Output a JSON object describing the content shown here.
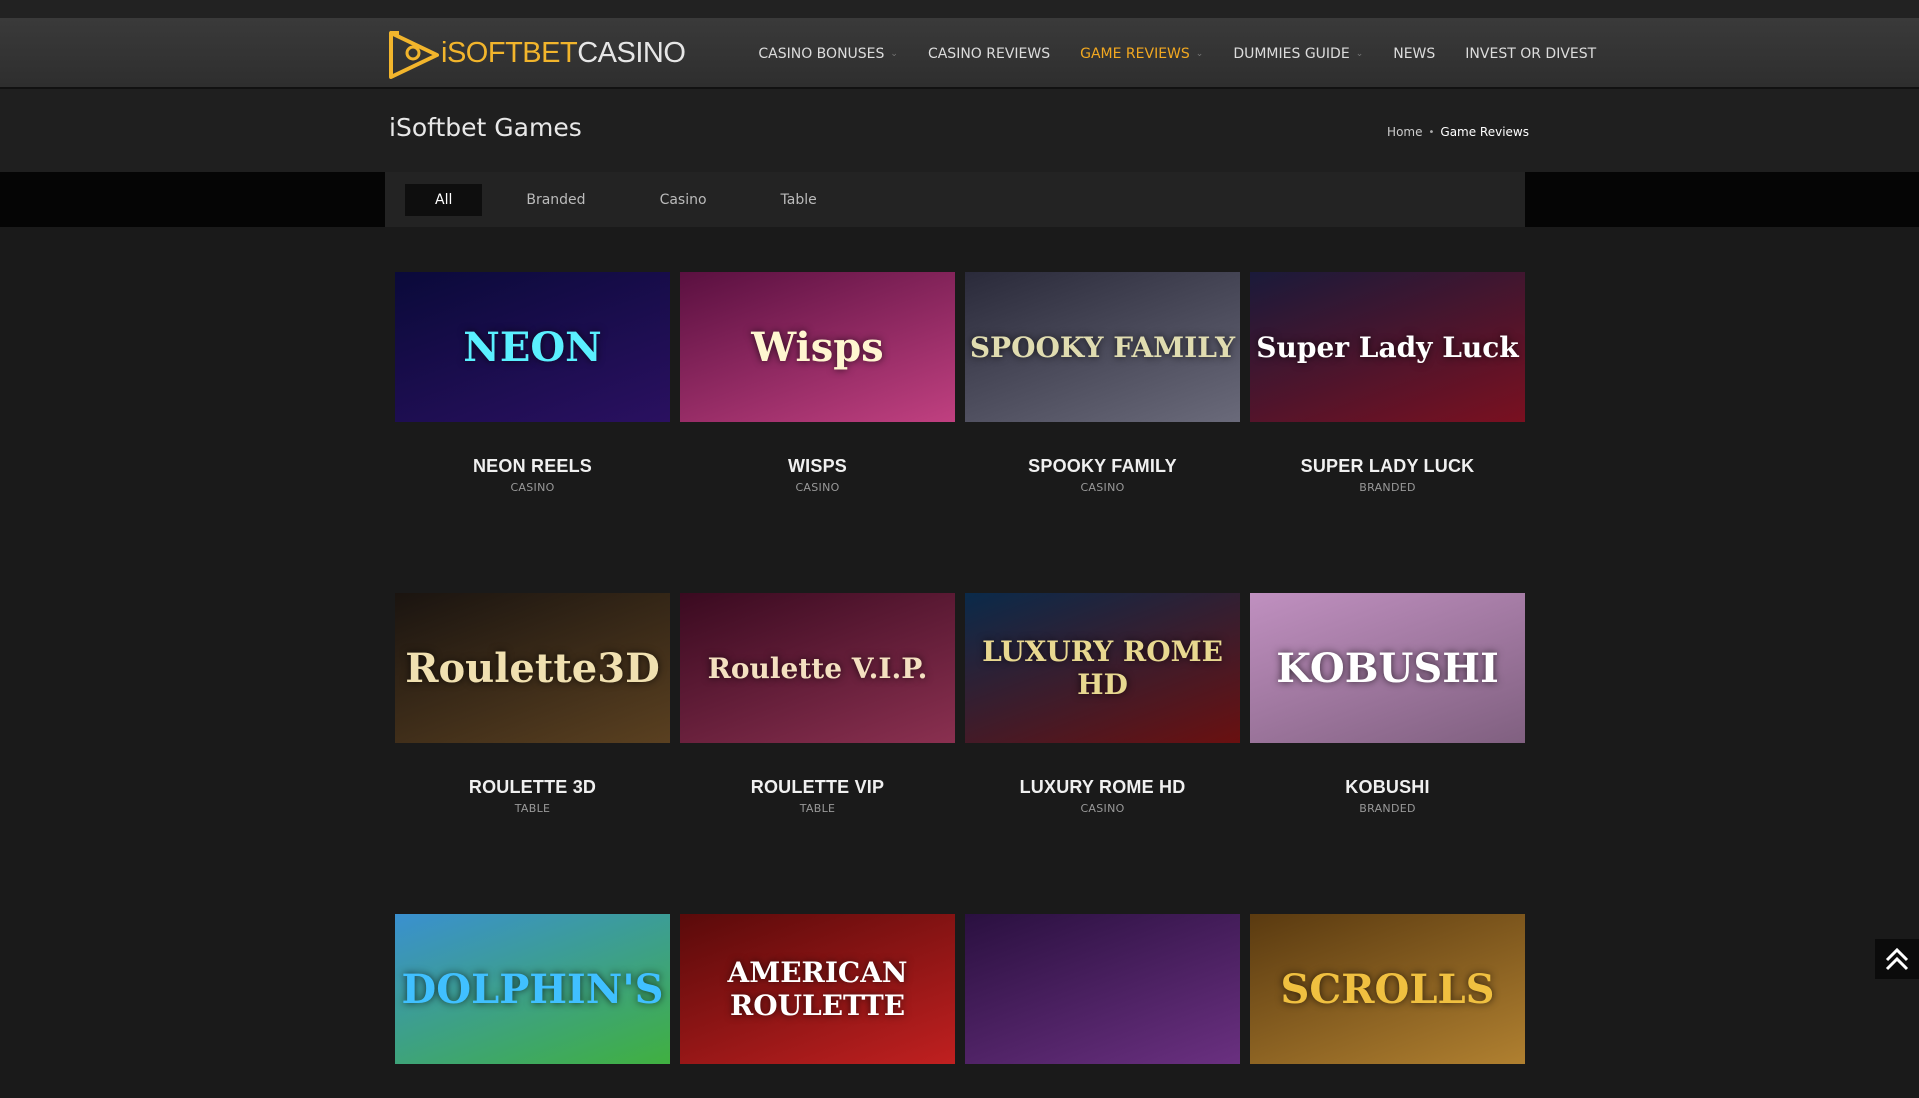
{
  "logo": {
    "prefix": "i",
    "mid": "SOFTBET",
    "suffix": "CASINO"
  },
  "nav": [
    {
      "label": "CASINO BONUSES",
      "dropdown": true,
      "active": false
    },
    {
      "label": "CASINO REVIEWS",
      "dropdown": false,
      "active": false
    },
    {
      "label": "GAME REVIEWS",
      "dropdown": true,
      "active": true
    },
    {
      "label": "DUMMIES GUIDE",
      "dropdown": true,
      "active": false
    },
    {
      "label": "NEWS",
      "dropdown": false,
      "active": false
    },
    {
      "label": "INVEST OR DIVEST",
      "dropdown": false,
      "active": false
    }
  ],
  "page": {
    "title": "iSoftbet Games"
  },
  "breadcrumb": {
    "home": "Home",
    "current": "Game Reviews"
  },
  "filters": [
    "All",
    "Branded",
    "Casino",
    "Table"
  ],
  "games": [
    {
      "title": "NEON REELS",
      "category": "CASINO",
      "art": "NEON",
      "colors": [
        "#0a0a3a",
        "#2a1060"
      ],
      "text_color": "#5af0ff"
    },
    {
      "title": "WISPS",
      "category": "CASINO",
      "art": "Wisps",
      "colors": [
        "#5a1040",
        "#c04080"
      ],
      "text_color": "#fff6d0"
    },
    {
      "title": "SPOOKY FAMILY",
      "category": "CASINO",
      "art": "SPOOKY FAMILY",
      "colors": [
        "#2a2a3a",
        "#6a6a7a"
      ],
      "text_color": "#e0dcb0"
    },
    {
      "title": "SUPER LADY LUCK",
      "category": "BRANDED",
      "art": "Super Lady Luck",
      "colors": [
        "#1a1a3a",
        "#7a1020"
      ],
      "text_color": "#ffffff"
    },
    {
      "title": "ROULETTE 3D",
      "category": "TABLE",
      "art": "Roulette3D",
      "colors": [
        "#1a1410",
        "#5a4020"
      ],
      "text_color": "#f0e0b0"
    },
    {
      "title": "ROULETTE VIP",
      "category": "TABLE",
      "art": "Roulette V.I.P.",
      "colors": [
        "#3a0a20",
        "#8a3050"
      ],
      "text_color": "#f4e0c0"
    },
    {
      "title": "LUXURY ROME HD",
      "category": "CASINO",
      "art": "LUXURY ROME HD",
      "colors": [
        "#0a2a4a",
        "#6a1010"
      ],
      "text_color": "#e8d890"
    },
    {
      "title": "KOBUSHI",
      "category": "BRANDED",
      "art": "KOBUSHI",
      "colors": [
        "#c090c0",
        "#806080"
      ],
      "text_color": "#ffffff"
    },
    {
      "title": "",
      "category": "",
      "art": "DOLPHIN'S",
      "colors": [
        "#3a90d0",
        "#40b040"
      ],
      "text_color": "#40c0ff"
    },
    {
      "title": "",
      "category": "",
      "art": "AMERICAN ROULETTE",
      "colors": [
        "#5a0a0a",
        "#c02020"
      ],
      "text_color": "#ffffff"
    },
    {
      "title": "",
      "category": "",
      "art": "",
      "colors": [
        "#2a1040",
        "#6a3080"
      ],
      "text_color": "#ffffff"
    },
    {
      "title": "",
      "category": "",
      "art": "SCROLLS",
      "colors": [
        "#5a3a10",
        "#b08030"
      ],
      "text_color": "#f0c040"
    }
  ]
}
